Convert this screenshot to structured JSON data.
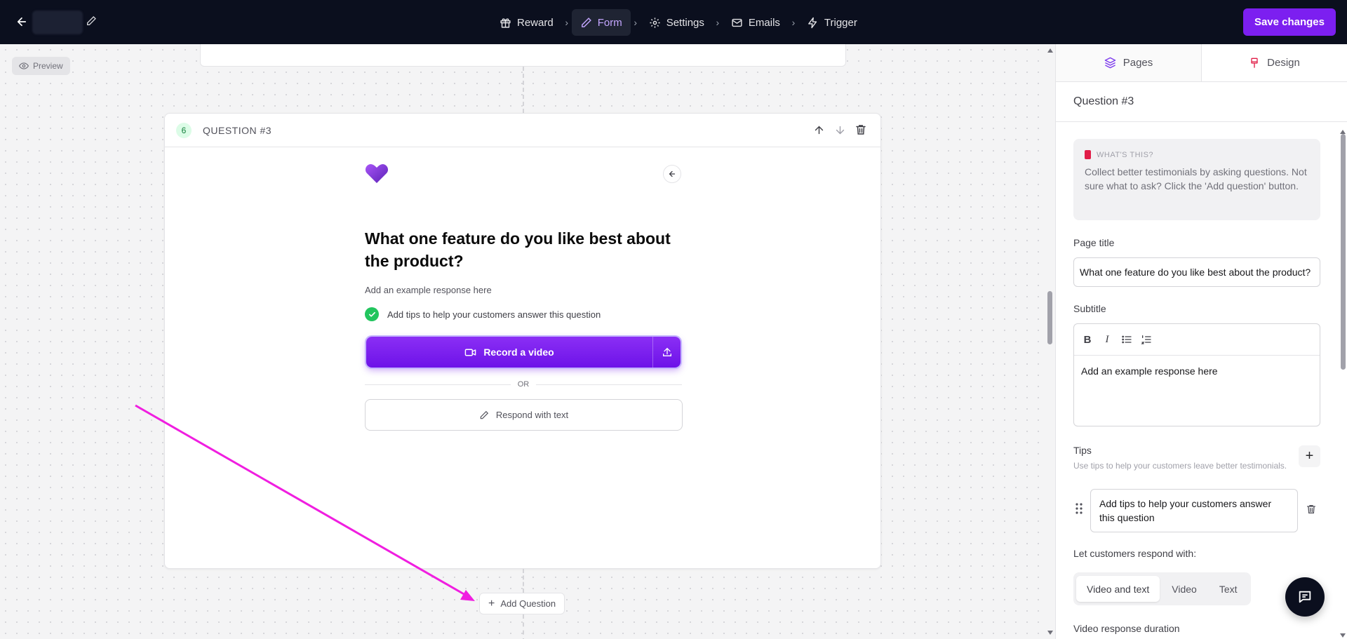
{
  "topbar": {
    "steps": [
      {
        "label": "Reward",
        "icon": "gift-icon"
      },
      {
        "label": "Form",
        "icon": "pencil-icon",
        "active": true
      },
      {
        "label": "Settings",
        "icon": "gear-icon"
      },
      {
        "label": "Emails",
        "icon": "mail-icon"
      },
      {
        "label": "Trigger",
        "icon": "bolt-icon"
      }
    ],
    "save_label": "Save changes",
    "accent_color": "#7c1ff0"
  },
  "canvas": {
    "preview_label": "Preview",
    "question_card": {
      "number": "6",
      "title": "QUESTION #3",
      "heading": "What one feature do you like best about the product?",
      "subtitle": "Add an example response here",
      "tip": "Add tips to help your customers answer this question",
      "record_label": "Record a video",
      "or_label": "OR",
      "text_label": "Respond with text"
    },
    "add_question_label": "Add Question"
  },
  "panel": {
    "tabs": [
      {
        "label": "Pages",
        "icon": "layers-icon",
        "active": true
      },
      {
        "label": "Design",
        "icon": "paint-icon"
      }
    ],
    "section_title": "Question #3",
    "info": {
      "heading": "WHAT'S THIS?",
      "text": "Collect better testimonials by asking questions. Not sure what to ask? Click the 'Add question' button."
    },
    "page_title_label": "Page title",
    "page_title_value": "What one feature do you like best about the product?",
    "subtitle_label": "Subtitle",
    "subtitle_value": "Add an example response here",
    "tips_label": "Tips",
    "tips_hint": "Use tips to help your customers leave better testimonials.",
    "tips": [
      "Add tips to help your customers answer this question"
    ],
    "respond_label": "Let customers respond with:",
    "respond_options": [
      "Video and text",
      "Video",
      "Text"
    ],
    "respond_selected": "Video and text",
    "duration_label": "Video response duration"
  }
}
